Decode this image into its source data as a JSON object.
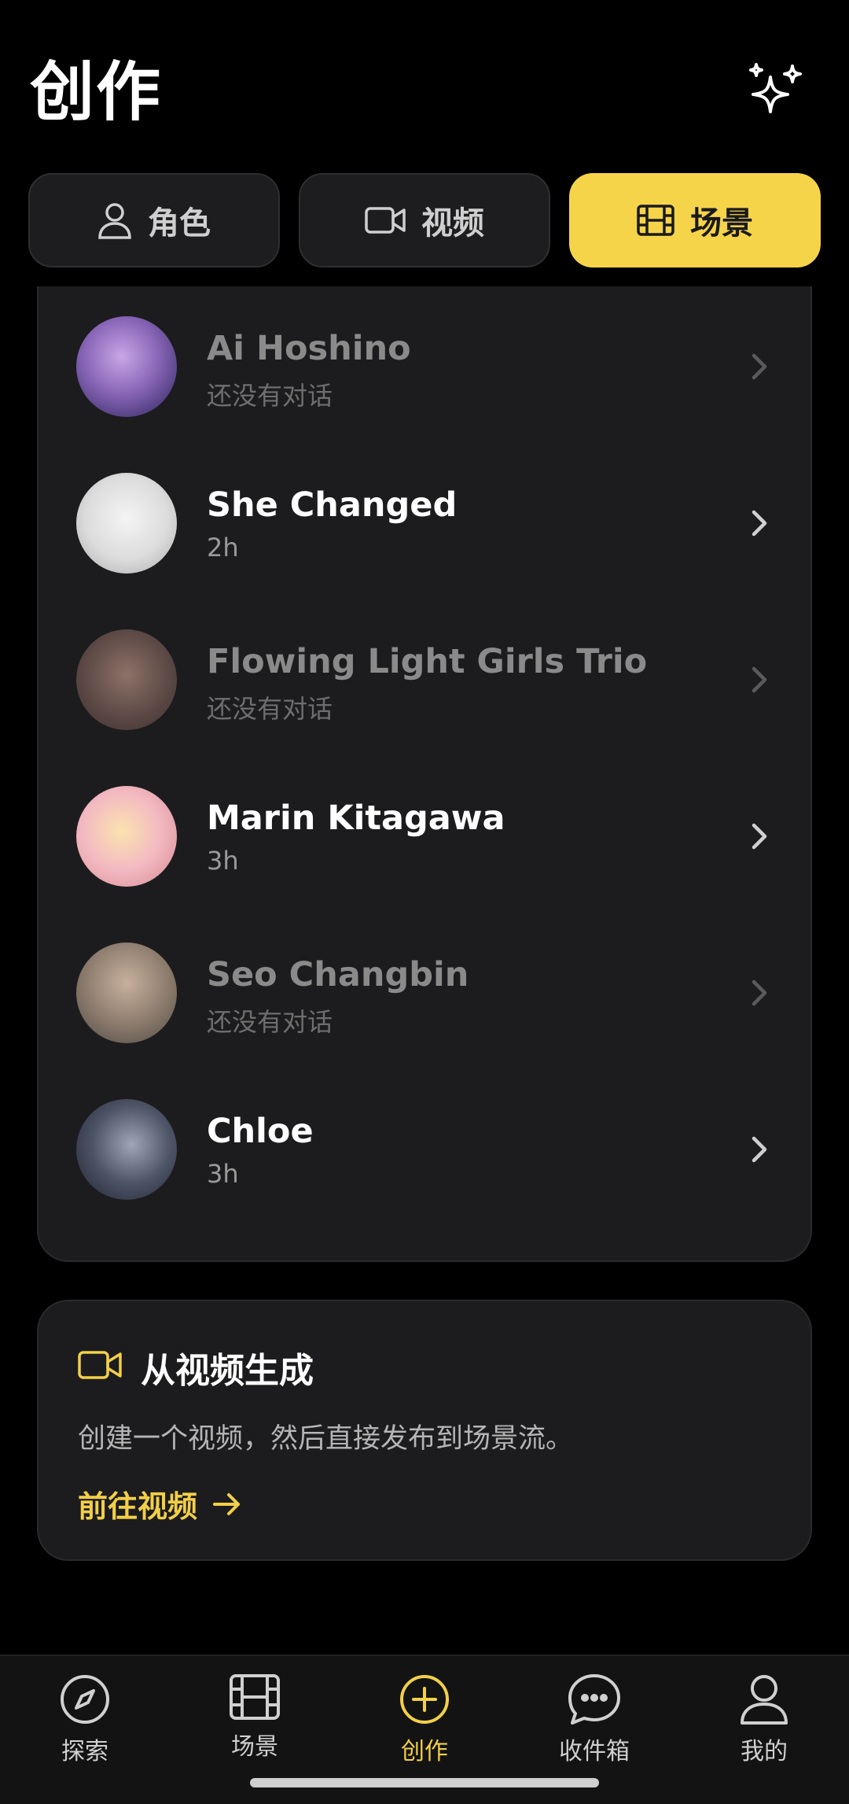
{
  "header": {
    "title": "创作"
  },
  "segments": [
    {
      "label": "角色",
      "icon": "person-icon",
      "active": false
    },
    {
      "label": "视频",
      "icon": "video-camera-icon",
      "active": false
    },
    {
      "label": "场景",
      "icon": "film-strip-icon",
      "active": true
    }
  ],
  "scenes": [
    {
      "name": "Ai Hoshino",
      "sub": "还没有对话",
      "dim": true
    },
    {
      "name": "She Changed",
      "sub": "2h",
      "dim": false
    },
    {
      "name": "Flowing Light Girls Trio",
      "sub": "还没有对话",
      "dim": true
    },
    {
      "name": "Marin Kitagawa",
      "sub": "3h",
      "dim": false
    },
    {
      "name": "Seo Changbin",
      "sub": "还没有对话",
      "dim": true
    },
    {
      "name": "Chloe",
      "sub": "3h",
      "dim": false
    }
  ],
  "video_card": {
    "title": "从视频生成",
    "description": "创建一个视频，然后直接发布到场景流。",
    "link": "前往视频"
  },
  "tabbar": [
    {
      "label": "探索",
      "icon": "compass-icon",
      "active": false
    },
    {
      "label": "场景",
      "icon": "film-strip-icon",
      "active": false
    },
    {
      "label": "创作",
      "icon": "plus-circle-icon",
      "active": true
    },
    {
      "label": "收件箱",
      "icon": "chat-bubble-icon",
      "active": false
    },
    {
      "label": "我的",
      "icon": "person-icon",
      "active": false
    }
  ],
  "colors": {
    "accent": "#f6d44a",
    "background": "#000000",
    "card": "#1c1c1e"
  }
}
